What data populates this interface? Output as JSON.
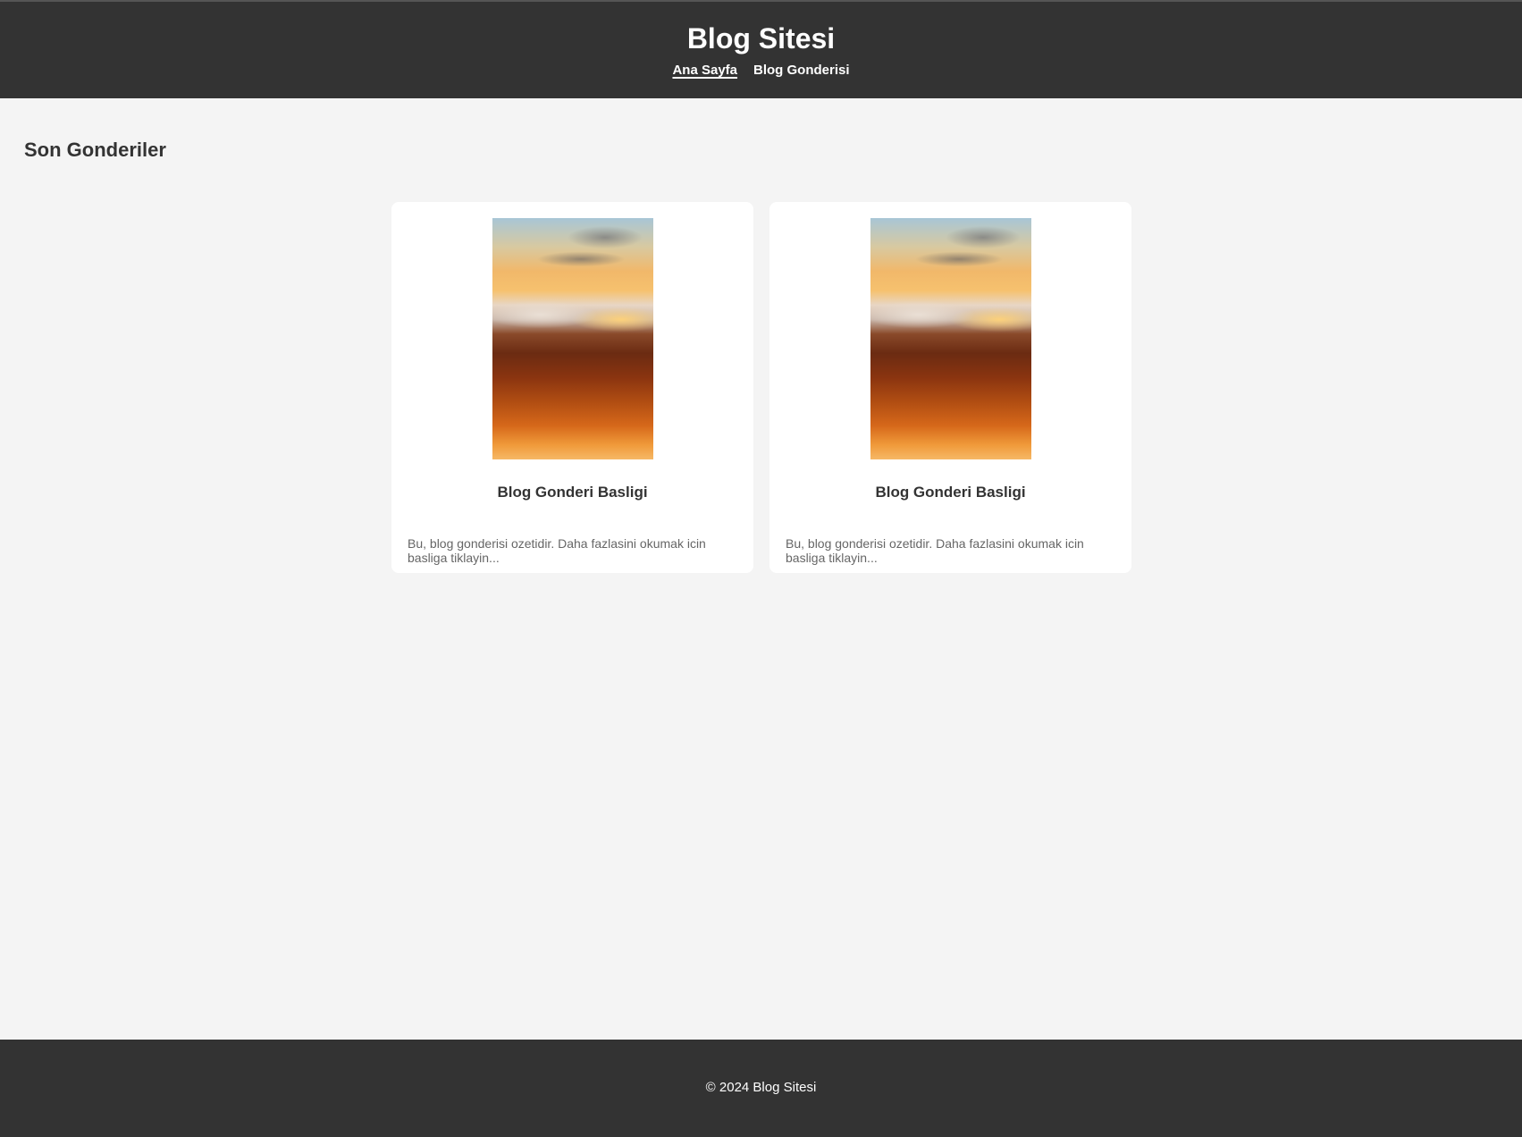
{
  "header": {
    "title": "Blog Sitesi",
    "nav": [
      {
        "label": "Ana Sayfa",
        "active": true
      },
      {
        "label": "Blog Gonderisi",
        "active": false
      }
    ]
  },
  "main": {
    "section_title": "Son Gonderiler",
    "posts": [
      {
        "title": "Blog Gonderi Basligi",
        "excerpt": "Bu, blog gonderisi ozetidir. Daha fazlasini okumak icin basliga tiklayin..."
      },
      {
        "title": "Blog Gonderi Basligi",
        "excerpt": "Bu, blog gonderisi ozetidir. Daha fazlasini okumak icin basliga tiklayin..."
      }
    ]
  },
  "footer": {
    "copyright": "© 2024 Blog Sitesi"
  },
  "colors": {
    "header_bg": "#333333",
    "page_bg": "#f4f4f4",
    "card_bg": "#ffffff",
    "text": "#333333",
    "muted_text": "#666666"
  }
}
